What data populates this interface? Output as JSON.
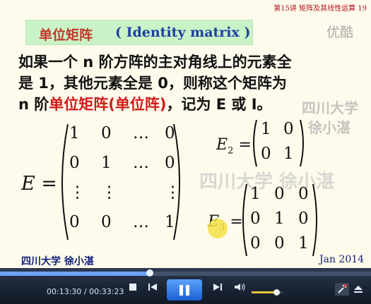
{
  "slide": {
    "header": "第15讲 矩阵及其线性运算 19",
    "title_cn": "单位矩阵",
    "title_en": "( Identity matrix )",
    "youku_logo": "优酷",
    "line1": "如果一个 n 阶方阵的主对角线上的元素全",
    "line2": "是 1，其他元素全是 0，则称这个矩阵为",
    "line3_a": "n 阶",
    "line3_b": "单位矩阵(单位阵)",
    "line3_c": "，记为 E 或 I。",
    "watermark1": "四川大学",
    "watermark2": "徐小湛",
    "watermark3": "四川大学  徐小湛",
    "matrix_E_label": "E =",
    "matrix_E": [
      [
        "1",
        "0",
        "…",
        "0"
      ],
      [
        "0",
        "1",
        "…",
        "0"
      ],
      [
        "⋮",
        "⋮",
        "",
        "⋮"
      ],
      [
        "0",
        "0",
        "…",
        "1"
      ]
    ],
    "matrix_E2_label": "E",
    "matrix_E2_sub": "2",
    "matrix_E2": [
      [
        "1",
        "0"
      ],
      [
        "0",
        "1"
      ]
    ],
    "matrix_E3_label": "E",
    "matrix_E3_sub": "3",
    "matrix_E3": [
      [
        "1",
        "0",
        "0"
      ],
      [
        "0",
        "1",
        "0"
      ],
      [
        "0",
        "0",
        "1"
      ]
    ],
    "footer_left": "四川大学  徐小湛",
    "footer_right": "Jan 2014"
  },
  "player": {
    "time": "00:13:30 / 00:33:23",
    "progress": 0.404,
    "volume": 0.8,
    "colors": {
      "accent": "#6fa3ff",
      "bar": "#1a2434",
      "volume": "#e6c53a"
    }
  }
}
